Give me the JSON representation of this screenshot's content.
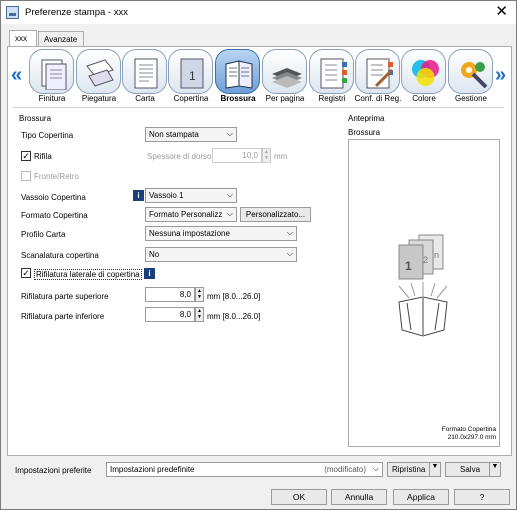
{
  "window": {
    "title": "Preferenze stampa - xxx",
    "close": "✕"
  },
  "tabs": [
    {
      "label": "xxx"
    },
    {
      "label": "Avanzate"
    }
  ],
  "toolbar": {
    "left_arrow": "«",
    "right_arrow": "»",
    "items": [
      {
        "label": "Finitura",
        "icon": "finishing-icon"
      },
      {
        "label": "Piegatura",
        "icon": "folding-icon"
      },
      {
        "label": "Carta",
        "icon": "paper-icon"
      },
      {
        "label": "Copertina",
        "icon": "cover-icon"
      },
      {
        "label": "Brossura",
        "icon": "perfect-binding-icon",
        "selected": true
      },
      {
        "label": "Per pagina",
        "icon": "per-page-icon"
      },
      {
        "label": "Registri",
        "icon": "registers-icon"
      },
      {
        "label": "Conf. di Reg.",
        "icon": "register-config-icon"
      },
      {
        "label": "Colore",
        "icon": "color-icon"
      },
      {
        "label": "Gestione",
        "icon": "management-icon"
      }
    ]
  },
  "binding": {
    "group": "Brossura",
    "cover_type_label": "Tipo Copertina",
    "cover_type_value": "Non stampata",
    "trim_label": "Rifila",
    "trim_checked": true,
    "spine_label": "Spessore di dorso",
    "spine_value": "10,0",
    "spine_unit": "mm",
    "duplex_label": "Fronte/Retro",
    "duplex_checked": false,
    "cover_tray_label": "Vassoio Copertina",
    "cover_tray_value": "Vassoio 1",
    "cover_format_label": "Formato Copertina",
    "cover_format_value": "Formato Personalizz",
    "custom_button": "Personalizzato...",
    "paper_profile_label": "Profilo Carta",
    "paper_profile_value": "Nessuna impostazione",
    "scoring_label": "Scanalatura copertina",
    "scoring_value": "No",
    "side_trim_label": "Rifilatura laterale di copertina",
    "side_trim_checked": true,
    "top_trim_label": "Rifilatura parte superiore",
    "top_trim_value": "8,0",
    "top_trim_unit": "mm [8.0...26.0]",
    "bottom_trim_label": "Rifilatura parte inferiore",
    "bottom_trim_value": "8,0",
    "bottom_trim_unit": "mm [8.0...26.0]",
    "info": "i"
  },
  "preview": {
    "group": "Anteprima",
    "caption": "Brossura",
    "format_line1": "Formato Copertina",
    "format_line2": "210.0x297.0 mm",
    "page_numbers": [
      "1",
      "2",
      "n"
    ]
  },
  "favorites": {
    "label": "Impostazioni preferite",
    "value": "Impostazioni predefinite",
    "state": "(modificato)",
    "restore": "Ripristina",
    "save": "Salva"
  },
  "dialog": {
    "ok": "OK",
    "cancel": "Annulla",
    "apply": "Applica",
    "help": "?"
  },
  "colors": {
    "accent": "#1d6fc4",
    "selected_bg": "#6f9ed8"
  }
}
